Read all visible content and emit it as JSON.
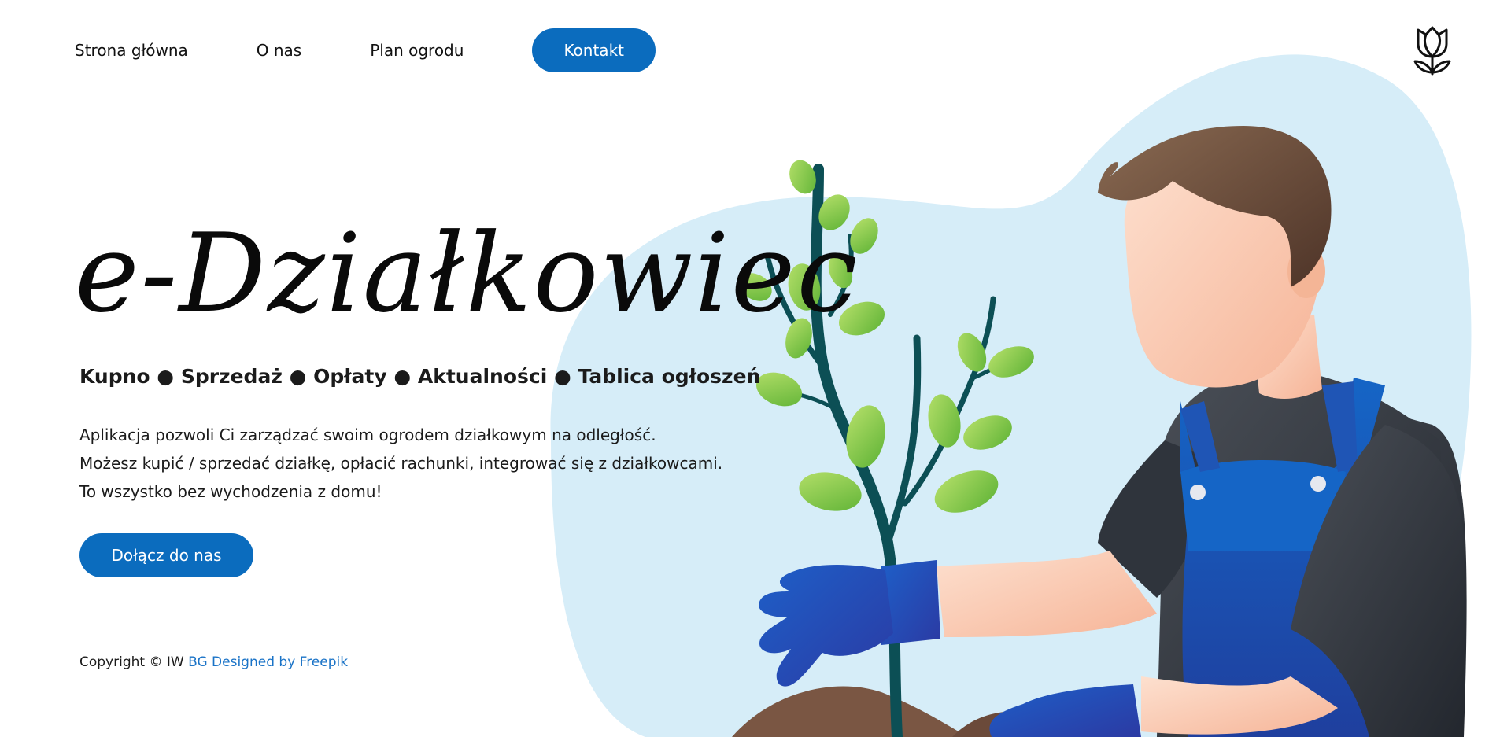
{
  "nav": {
    "items": [
      {
        "label": "Strona główna"
      },
      {
        "label": "O nas"
      },
      {
        "label": "Plan ogrodu"
      }
    ],
    "cta_label": "Kontakt"
  },
  "logo": {
    "icon": "tulip-icon"
  },
  "hero": {
    "title": "e-Działkowiec",
    "subtitle": "Kupno ● Sprzedaż ● Opłaty ● Aktualności ● Tablica ogłoszeń",
    "description": [
      "Aplikacja pozwoli Ci zarządzać swoim ogrodem działkowym na odległość.",
      "Możesz kupić / sprzedać działkę, opłacić rachunki, integrować się z działkowcami.",
      "To wszystko bez wychodzenia z domu!"
    ],
    "cta_label": "Dołącz do nas"
  },
  "footer": {
    "copyright": "Copyright © IW",
    "credit_link": "BG Designed by Freepik"
  },
  "colors": {
    "accent": "#0b6cbe",
    "blob": "#d6edf8",
    "link": "#1a73c7"
  }
}
